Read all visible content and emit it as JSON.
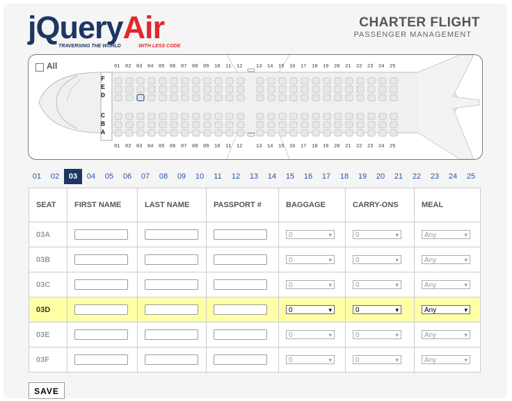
{
  "brand": {
    "name_j": "jQuery",
    "name_air": "Air",
    "tagline_left": "TRAVERSING THE WORLD",
    "tagline_right": "WITH LESS CODE"
  },
  "header": {
    "title": "CHARTER FLIGHT",
    "subtitle": "PASSENGER MANAGEMENT"
  },
  "seatmap": {
    "all_label": "All",
    "row_numbers": [
      "01",
      "02",
      "03",
      "04",
      "05",
      "06",
      "07",
      "08",
      "09",
      "10",
      "11",
      "12",
      "13",
      "14",
      "15",
      "16",
      "17",
      "18",
      "19",
      "20",
      "21",
      "22",
      "23",
      "24",
      "25"
    ],
    "upper_letters": [
      "F",
      "E",
      "D"
    ],
    "lower_letters": [
      "C",
      "B",
      "A"
    ],
    "selected_seat_icon": "passenger-seat-icon"
  },
  "row_tabs": [
    "01",
    "02",
    "03",
    "04",
    "05",
    "06",
    "07",
    "08",
    "09",
    "10",
    "11",
    "12",
    "13",
    "14",
    "15",
    "16",
    "17",
    "18",
    "19",
    "20",
    "21",
    "22",
    "23",
    "24",
    "25"
  ],
  "active_row": "03",
  "table": {
    "headers": {
      "seat": "SEAT",
      "first": "FIRST NAME",
      "last": "LAST NAME",
      "passport": "PASSPORT #",
      "baggage": "BAGGAGE",
      "carry": "CARRY-ONS",
      "meal": "MEAL"
    },
    "rows": [
      {
        "seat": "03A",
        "baggage": "0",
        "carry": "0",
        "meal": "Any"
      },
      {
        "seat": "03B",
        "baggage": "0",
        "carry": "0",
        "meal": "Any"
      },
      {
        "seat": "03C",
        "baggage": "0",
        "carry": "0",
        "meal": "Any"
      },
      {
        "seat": "03D",
        "baggage": "0",
        "carry": "0",
        "meal": "Any"
      },
      {
        "seat": "03E",
        "baggage": "0",
        "carry": "0",
        "meal": "Any"
      },
      {
        "seat": "03F",
        "baggage": "0",
        "carry": "0",
        "meal": "Any"
      }
    ]
  },
  "save_label": "SAVE"
}
